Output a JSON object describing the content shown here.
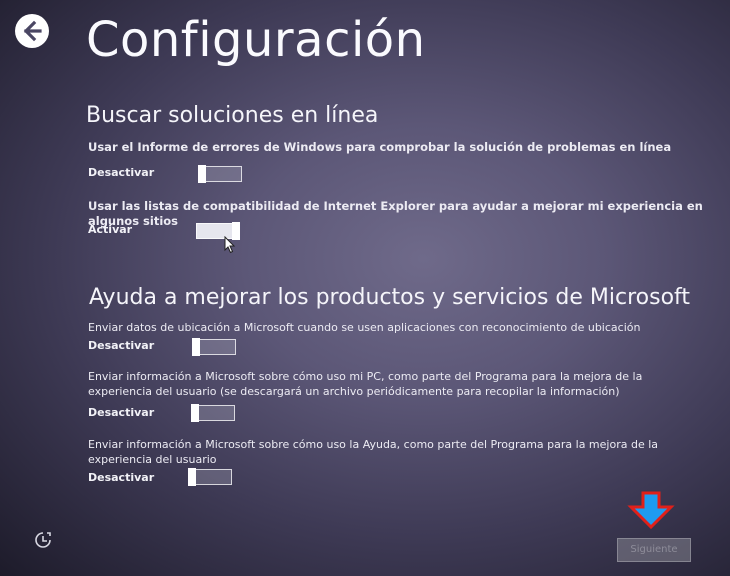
{
  "page": {
    "title": "Configuración"
  },
  "sections": [
    {
      "heading": "Buscar soluciones en línea",
      "settings": [
        {
          "description": "Usar el Informe de errores de Windows para comprobar la solución de problemas en línea",
          "state_label": "Desactivar",
          "enabled": false
        },
        {
          "description": "Usar las listas de compatibilidad de Internet Explorer para ayudar a mejorar mi experiencia en algunos sitios",
          "state_label": "Activar",
          "enabled": true
        }
      ]
    },
    {
      "heading": "Ayuda a mejorar los productos y servicios de Microsoft",
      "settings": [
        {
          "description": "Enviar datos de ubicación a Microsoft cuando se usen aplicaciones con reconocimiento de ubicación",
          "state_label": "Desactivar",
          "enabled": false
        },
        {
          "description": "Enviar información a Microsoft sobre cómo uso mi PC, como parte del Programa para la mejora de la experiencia del usuario (se descargará un archivo periódicamente para recopilar la información)",
          "state_label": "Desactivar",
          "enabled": false
        },
        {
          "description": "Enviar información a Microsoft sobre cómo uso la Ayuda, como parte del Programa para la mejora de la experiencia del usuario",
          "state_label": "Desactivar",
          "enabled": false
        }
      ]
    }
  ],
  "footer": {
    "next_label": "Siguiente"
  },
  "icons": {
    "back": "back-arrow-icon",
    "ease_of_access": "ease-of-access-icon",
    "annotation": "down-arrow-annotation-icon"
  },
  "colors": {
    "annotation_fill": "#1e9bf0",
    "annotation_outline": "#e0201a"
  }
}
